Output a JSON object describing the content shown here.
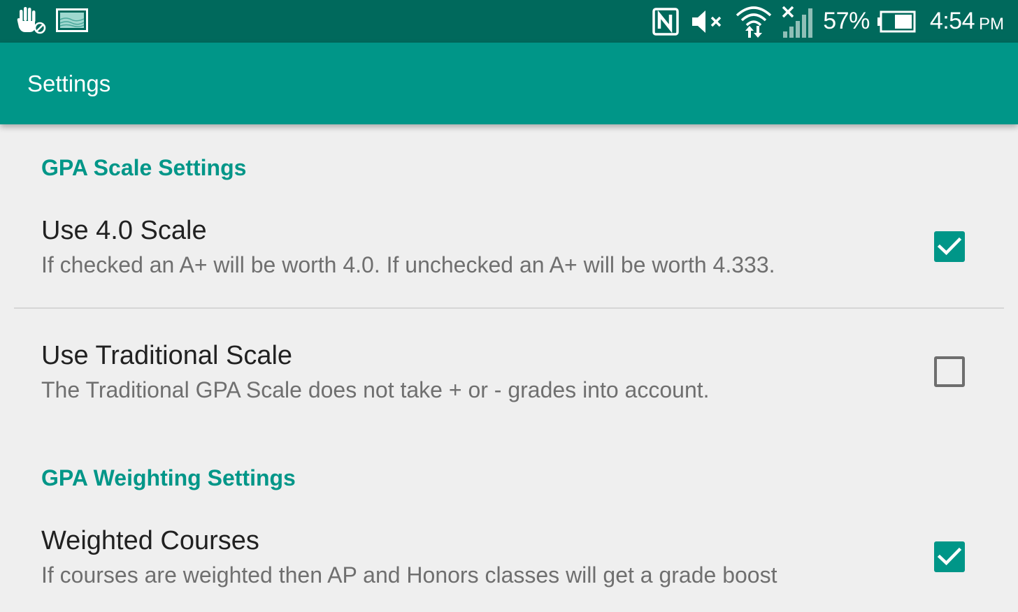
{
  "status_bar": {
    "left_icons": [
      "hand-blocked-icon",
      "screenshot-gallery-icon"
    ],
    "right_icons": [
      "nfc-icon",
      "volume-muted-icon",
      "wifi-data-icon",
      "signal-no-sim-icon",
      "battery-icon"
    ],
    "battery_percent": "57%",
    "time": "4:54",
    "ampm": "PM"
  },
  "app_bar": {
    "title": "Settings"
  },
  "colors": {
    "status_bar": "#00695c",
    "app_bar": "#009688",
    "accent": "#009688",
    "background": "#efefef"
  },
  "sections": [
    {
      "title": "GPA Scale Settings",
      "items": [
        {
          "title": "Use 4.0 Scale",
          "summary": "If checked an A+ will be worth 4.0. If unchecked an A+ will be worth 4.333.",
          "checked": true
        },
        {
          "title": "Use Traditional Scale",
          "summary": "The Traditional GPA Scale does not take + or - grades into account.",
          "checked": false
        }
      ]
    },
    {
      "title": "GPA Weighting Settings",
      "items": [
        {
          "title": "Weighted Courses",
          "summary": "If courses are weighted then AP and Honors classes will get a grade boost",
          "checked": true
        }
      ]
    }
  ]
}
